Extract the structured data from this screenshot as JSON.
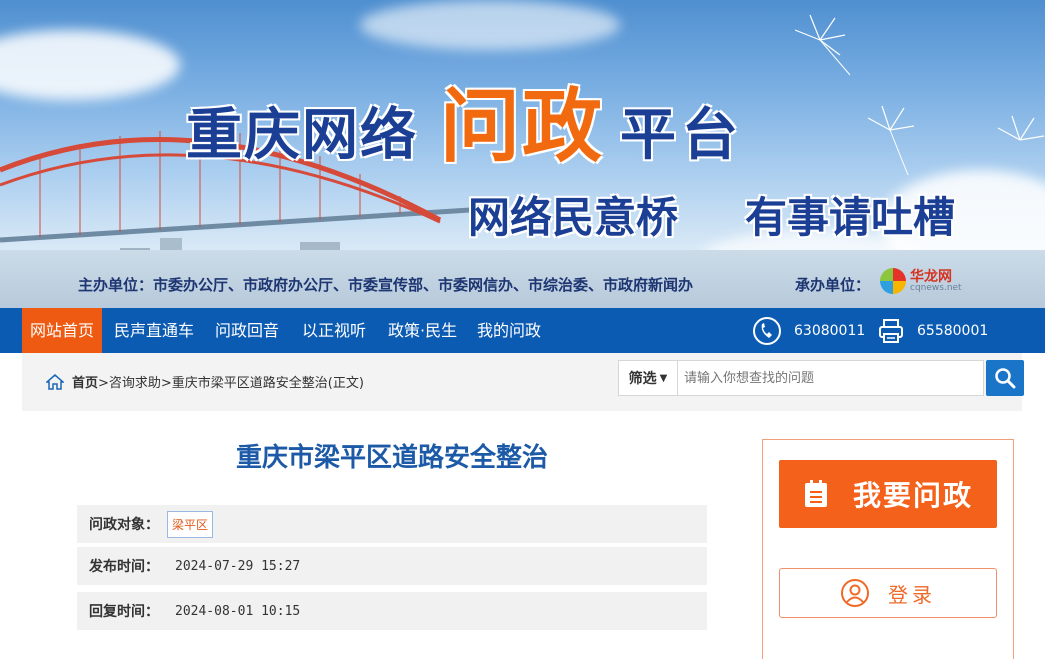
{
  "banner": {
    "title_part1": "重庆网络",
    "title_part2": "问政",
    "title_part3": "平台",
    "slogan_left": "网络民意桥",
    "slogan_right": "有事请吐槽",
    "sponsors": "主办单位：市委办公厅、市政府办公厅、市委宣传部、市委网信办、市综治委、市政府新闻办",
    "organizer_label": "承办单位：",
    "organizer_name": "华龙网",
    "organizer_domain": "cqnews.net"
  },
  "nav": {
    "items": [
      "网站首页",
      "民声直通车",
      "问政回音",
      "以正视听",
      "政策·民生",
      "我的问政"
    ],
    "phone": "63080011",
    "fax": "65580001"
  },
  "breadcrumb": {
    "home": "首页",
    "path": ">咨询求助>重庆市梁平区道路安全整治(正文)"
  },
  "search": {
    "filter_label": "筛选",
    "placeholder": "请输入你想查找的问题"
  },
  "article": {
    "title": "重庆市梁平区道路安全整治",
    "target_label": "问政对象：",
    "target_value": "梁平区",
    "published_label": "发布时间：",
    "published_value": "2024-07-29 15:27",
    "replied_label": "回复时间：",
    "replied_value": "2024-08-01 10:15"
  },
  "sidebar": {
    "ask_label": "我要问政",
    "login_label": "登录"
  },
  "colors": {
    "nav_blue": "#0c5bb3",
    "accent_orange": "#f4611b",
    "title_blue": "#1c5aa7"
  }
}
